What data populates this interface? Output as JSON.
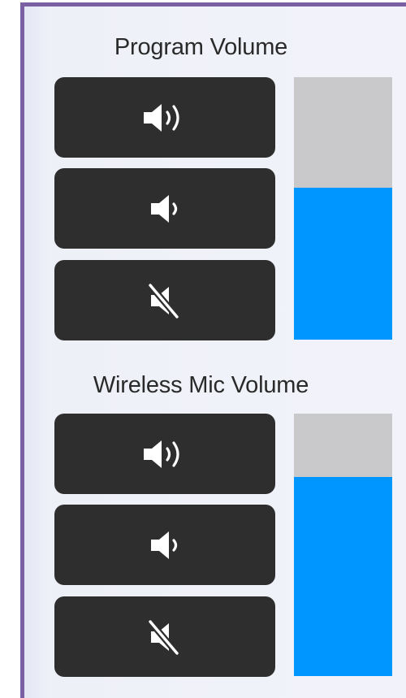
{
  "colors": {
    "panel_border": "#7b5fa3",
    "button_bg": "#2e2e2e",
    "meter_track": "#c9c9cc",
    "meter_fill": "#0096ff",
    "icon": "#ffffff"
  },
  "program": {
    "title": "Program Volume",
    "buttons": [
      {
        "icon": "volume-up-icon"
      },
      {
        "icon": "volume-down-icon"
      },
      {
        "icon": "mute-icon"
      }
    ],
    "level": 0.58
  },
  "mic": {
    "title": "Wireless Mic Volume",
    "buttons": [
      {
        "icon": "volume-up-icon"
      },
      {
        "icon": "volume-down-icon"
      },
      {
        "icon": "mute-icon"
      }
    ],
    "level": 0.76
  }
}
